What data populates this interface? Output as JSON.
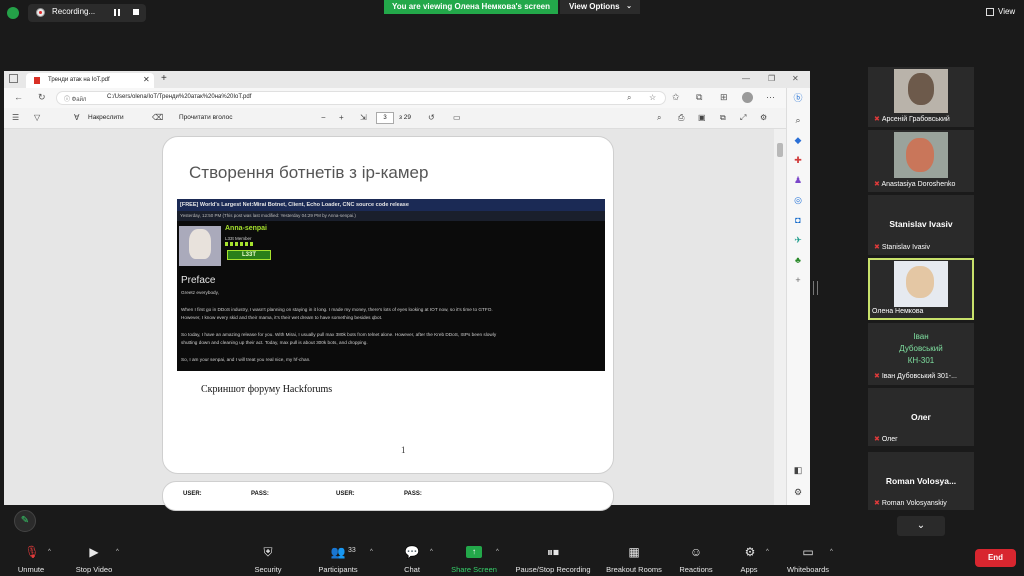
{
  "recording": {
    "label": "Recording..."
  },
  "banner": {
    "viewing": "You are viewing Олена Немкова's screen",
    "view_options": "View Options",
    "view_options_chevron": "⌄",
    "view": "View"
  },
  "browser": {
    "tab_title": "Тренди атак на IoT.pdf",
    "tab_close": "✕",
    "new_tab": "+",
    "url_label": "Файл",
    "url": "C:/Users/olena/IoT/Тренди%20атак%20на%20IoT.pdf",
    "toolbar": {
      "draw_label": "Накреслити",
      "read_aloud": "Прочитати вголос",
      "page_current": "3",
      "page_total": "з 29",
      "zoom_minus": "−",
      "zoom_plus": "+"
    }
  },
  "slide": {
    "title": "Створення ботнетів з ip-камер",
    "caption": "Скриншот форуму Hackforums",
    "page_number": "1",
    "forum": {
      "header": "[FREE] World's Largest Net:Mirai Botnet, Client, Echo Loader, CNC source code release",
      "subheader": "Yesterday, 12:50 PM (This post was last modified: Yesterday 04:29 PM by Anna-senpai.)",
      "user": "Anna-senpai",
      "rank": "L33t Member",
      "badge": "L33T",
      "preface": "Preface",
      "lines": [
        "Greetz everybody,",
        "When I first go in DDoS industry, I wasn't planning on staying in it long. I made my money, there's lots of eyes looking at IOT now, so it's time to GTFO.",
        "However, I know every skid and their mama, it's their wet dream to have something besides qbot.",
        "So today, I have an amazing release for you. With Mirai, I usually pull max 380k bots from telnet alone. However, after the Kreb DDoS, ISPs been slowly",
        "shutting down and cleaning up their act. Today, max pull is about 300k bots, and dropping.",
        "So, I am your senpai, and I will treat you real nice, my hf-chan."
      ]
    },
    "next_page": {
      "cols": [
        "USER:",
        "PASS:",
        "USER:",
        "PASS:"
      ]
    }
  },
  "participants": [
    {
      "name": "Арсеній Грабовський",
      "muted": true,
      "has_video": true
    },
    {
      "name": "Anastasiya Doroshenko",
      "muted": true,
      "has_video": true
    },
    {
      "name": "Stanislav Ivasiv",
      "display": "Stanislav Ivasiv",
      "muted": true,
      "has_video": false
    },
    {
      "name": "Олена Немкова",
      "muted": false,
      "has_video": true,
      "active": true
    },
    {
      "name": "Іван Дубовський 301-...",
      "display": "Іван Дубовський КН-301",
      "muted": true,
      "has_video": false
    },
    {
      "name": "Олег",
      "display": "Олег",
      "muted": true,
      "has_video": false
    },
    {
      "name": "Roman Volosyanskiy",
      "display": "Roman Volosya...",
      "muted": true,
      "has_video": false
    }
  ],
  "bottom_toolbar": {
    "unmute": "Unmute",
    "stop_video": "Stop Video",
    "security": "Security",
    "participants": "Participants",
    "participants_count": "33",
    "chat": "Chat",
    "share_screen": "Share Screen",
    "pause_recording": "Pause/Stop Recording",
    "breakout_rooms": "Breakout Rooms",
    "reactions": "Reactions",
    "apps": "Apps",
    "whiteboards": "Whiteboards",
    "end": "End"
  },
  "colors": {
    "accent_green": "#23a84a",
    "end_red": "#d8262f",
    "active_speaker": "#c8e16b",
    "muted_red": "#e03a3a"
  }
}
